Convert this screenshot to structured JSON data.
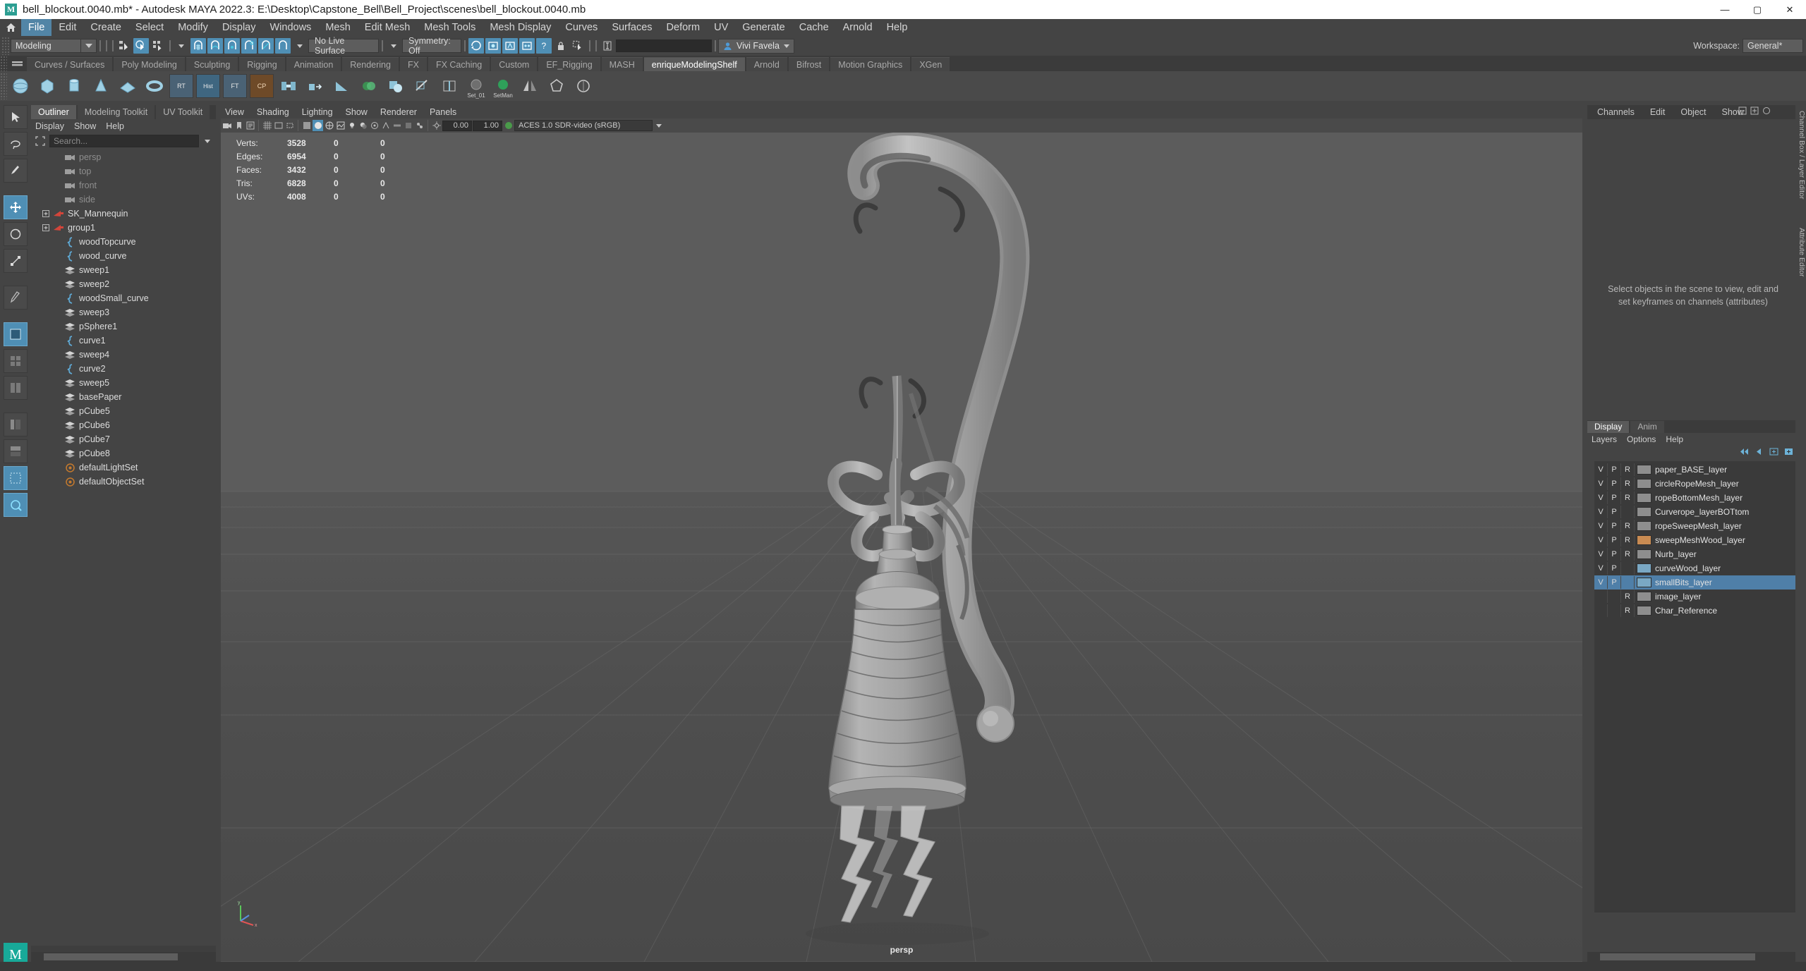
{
  "window": {
    "title": "bell_blockout.0040.mb* - Autodesk MAYA 2022.3: E:\\Desktop\\Capstone_Bell\\Bell_Project\\scenes\\bell_blockout.0040.mb",
    "app_icon": "M",
    "minimize": "—",
    "maximize": "▢",
    "close": "✕"
  },
  "menubar": {
    "home_icon": "home-icon",
    "items": [
      {
        "label": "File",
        "active": true
      },
      {
        "label": "Edit",
        "active": false
      },
      {
        "label": "Create",
        "active": false
      },
      {
        "label": "Select",
        "active": false
      },
      {
        "label": "Modify",
        "active": false
      },
      {
        "label": "Display",
        "active": false
      },
      {
        "label": "Windows",
        "active": false
      },
      {
        "label": "Mesh",
        "active": false
      },
      {
        "label": "Edit Mesh",
        "active": false
      },
      {
        "label": "Mesh Tools",
        "active": false
      },
      {
        "label": "Mesh Display",
        "active": false
      },
      {
        "label": "Curves",
        "active": false
      },
      {
        "label": "Surfaces",
        "active": false
      },
      {
        "label": "Deform",
        "active": false
      },
      {
        "label": "UV",
        "active": false
      },
      {
        "label": "Generate",
        "active": false
      },
      {
        "label": "Cache",
        "active": false
      },
      {
        "label": "Arnold",
        "active": false
      },
      {
        "label": "Help",
        "active": false
      }
    ]
  },
  "statusline": {
    "mode": "Modeling",
    "live_surface": "No Live Surface",
    "symmetry": "Symmetry: Off",
    "command_value": "",
    "user": "Vivi Favela",
    "workspace_label": "Workspace:",
    "workspace": "General*"
  },
  "shelf": {
    "tabs": [
      {
        "label": "Curves / Surfaces",
        "active": false
      },
      {
        "label": "Poly Modeling",
        "active": false
      },
      {
        "label": "Sculpting",
        "active": false
      },
      {
        "label": "Rigging",
        "active": false
      },
      {
        "label": "Animation",
        "active": false
      },
      {
        "label": "Rendering",
        "active": false
      },
      {
        "label": "FX",
        "active": false
      },
      {
        "label": "FX Caching",
        "active": false
      },
      {
        "label": "Custom",
        "active": false
      },
      {
        "label": "EF_Rigging",
        "active": false
      },
      {
        "label": "MASH",
        "active": false
      },
      {
        "label": "enriqueModelingShelf",
        "active": true
      },
      {
        "label": "Arnold",
        "active": false
      },
      {
        "label": "Bifrost",
        "active": false
      },
      {
        "label": "Motion Graphics",
        "active": false
      },
      {
        "label": "XGen",
        "active": false
      }
    ],
    "icon_labels": {
      "set_01": "Set_01",
      "set_man": "SetMan"
    }
  },
  "outliner": {
    "tabs": [
      {
        "label": "Outliner",
        "active": true
      },
      {
        "label": "Modeling Toolkit",
        "active": false
      },
      {
        "label": "UV Toolkit",
        "active": false
      }
    ],
    "menu": [
      "Display",
      "Show",
      "Help"
    ],
    "search_placeholder": "Search...",
    "items": [
      {
        "label": "persp",
        "icon": "camera-icon",
        "dim": true,
        "indent": 1,
        "expandable": false
      },
      {
        "label": "top",
        "icon": "camera-icon",
        "dim": true,
        "indent": 1,
        "expandable": false
      },
      {
        "label": "front",
        "icon": "camera-icon",
        "dim": true,
        "indent": 1,
        "expandable": false
      },
      {
        "label": "side",
        "icon": "camera-icon",
        "dim": true,
        "indent": 1,
        "expandable": false
      },
      {
        "label": "SK_Mannequin",
        "icon": "transform-icon",
        "dim": false,
        "indent": 0,
        "expandable": true
      },
      {
        "label": "group1",
        "icon": "transform-icon",
        "dim": false,
        "indent": 0,
        "expandable": true
      },
      {
        "label": "woodTopcurve",
        "icon": "curve-icon",
        "dim": false,
        "indent": 1,
        "expandable": false
      },
      {
        "label": "wood_curve",
        "icon": "curve-icon",
        "dim": false,
        "indent": 1,
        "expandable": false
      },
      {
        "label": "sweep1",
        "icon": "mesh-icon",
        "dim": false,
        "indent": 1,
        "expandable": false
      },
      {
        "label": "sweep2",
        "icon": "mesh-icon",
        "dim": false,
        "indent": 1,
        "expandable": false
      },
      {
        "label": "woodSmall_curve",
        "icon": "curve-icon",
        "dim": false,
        "indent": 1,
        "expandable": false
      },
      {
        "label": "sweep3",
        "icon": "mesh-icon",
        "dim": false,
        "indent": 1,
        "expandable": false
      },
      {
        "label": "pSphere1",
        "icon": "mesh-icon",
        "dim": false,
        "indent": 1,
        "expandable": false
      },
      {
        "label": "curve1",
        "icon": "curve-icon",
        "dim": false,
        "indent": 1,
        "expandable": false
      },
      {
        "label": "sweep4",
        "icon": "mesh-icon",
        "dim": false,
        "indent": 1,
        "expandable": false
      },
      {
        "label": "curve2",
        "icon": "curve-icon",
        "dim": false,
        "indent": 1,
        "expandable": false
      },
      {
        "label": "sweep5",
        "icon": "mesh-icon",
        "dim": false,
        "indent": 1,
        "expandable": false
      },
      {
        "label": "basePaper",
        "icon": "mesh-icon",
        "dim": false,
        "indent": 1,
        "expandable": false
      },
      {
        "label": "pCube5",
        "icon": "mesh-icon",
        "dim": false,
        "indent": 1,
        "expandable": false
      },
      {
        "label": "pCube6",
        "icon": "mesh-icon",
        "dim": false,
        "indent": 1,
        "expandable": false
      },
      {
        "label": "pCube7",
        "icon": "mesh-icon",
        "dim": false,
        "indent": 1,
        "expandable": false
      },
      {
        "label": "pCube8",
        "icon": "mesh-icon",
        "dim": false,
        "indent": 1,
        "expandable": false
      },
      {
        "label": "defaultLightSet",
        "icon": "set-icon",
        "dim": false,
        "indent": 1,
        "expandable": false
      },
      {
        "label": "defaultObjectSet",
        "icon": "set-icon",
        "dim": false,
        "indent": 1,
        "expandable": false
      }
    ]
  },
  "viewport": {
    "menu": [
      "View",
      "Shading",
      "Lighting",
      "Show",
      "Renderer",
      "Panels"
    ],
    "exposure": "0.00",
    "gamma": "1.00",
    "color_space": "ACES 1.0 SDR-video (sRGB)",
    "camera_label": "persp",
    "heads_up": {
      "rows": [
        {
          "label": "Verts:",
          "total": "3528",
          "sel": "0",
          "extra": "0"
        },
        {
          "label": "Edges:",
          "total": "6954",
          "sel": "0",
          "extra": "0"
        },
        {
          "label": "Faces:",
          "total": "3432",
          "sel": "0",
          "extra": "0"
        },
        {
          "label": "Tris:",
          "total": "6828",
          "sel": "0",
          "extra": "0"
        },
        {
          "label": "UVs:",
          "total": "4008",
          "sel": "0",
          "extra": "0"
        }
      ]
    }
  },
  "channelbox": {
    "tabs": [
      "Channels",
      "Edit",
      "Object",
      "Show"
    ],
    "empty_message": "Select objects in the scene to view, edit and set keyframes on channels (attributes)"
  },
  "layer_editor": {
    "mode_tabs": [
      {
        "label": "Display",
        "active": true
      },
      {
        "label": "Anim",
        "active": false
      }
    ],
    "menu": [
      "Layers",
      "Options",
      "Help"
    ],
    "layers": [
      {
        "v": "V",
        "p": "P",
        "r": "R",
        "name": "paper_BASE_layer",
        "color": "#8e8e8e",
        "selected": false
      },
      {
        "v": "V",
        "p": "P",
        "r": "R",
        "name": "circleRopeMesh_layer",
        "color": "#8e8e8e",
        "selected": false
      },
      {
        "v": "V",
        "p": "P",
        "r": "R",
        "name": "ropeBottomMesh_layer",
        "color": "#8e8e8e",
        "selected": false
      },
      {
        "v": "V",
        "p": "P",
        "r": "",
        "name": "Curverope_layerBOTtom",
        "color": "#8e8e8e",
        "selected": false
      },
      {
        "v": "V",
        "p": "P",
        "r": "R",
        "name": "ropeSweepMesh_layer",
        "color": "#8e8e8e",
        "selected": false
      },
      {
        "v": "V",
        "p": "P",
        "r": "R",
        "name": "sweepMeshWood_layer",
        "color": "#c98b52",
        "selected": false
      },
      {
        "v": "V",
        "p": "P",
        "r": "R",
        "name": "Nurb_layer",
        "color": "#8e8e8e",
        "selected": false
      },
      {
        "v": "V",
        "p": "P",
        "r": "",
        "name": "curveWood_layer",
        "color": "#7aa8c4",
        "selected": false
      },
      {
        "v": "V",
        "p": "P",
        "r": "",
        "name": "smallBits_layer",
        "color": "#7aa8c4",
        "selected": true
      },
      {
        "v": "",
        "p": "",
        "r": "R",
        "name": "image_layer",
        "color": "#8e8e8e",
        "selected": false
      },
      {
        "v": "",
        "p": "",
        "r": "R",
        "name": "Char_Reference",
        "color": "#8e8e8e",
        "selected": false
      }
    ]
  },
  "right_strip": {
    "labels": [
      "Channel Box / Layer Editor",
      "Attribute Editor"
    ]
  }
}
